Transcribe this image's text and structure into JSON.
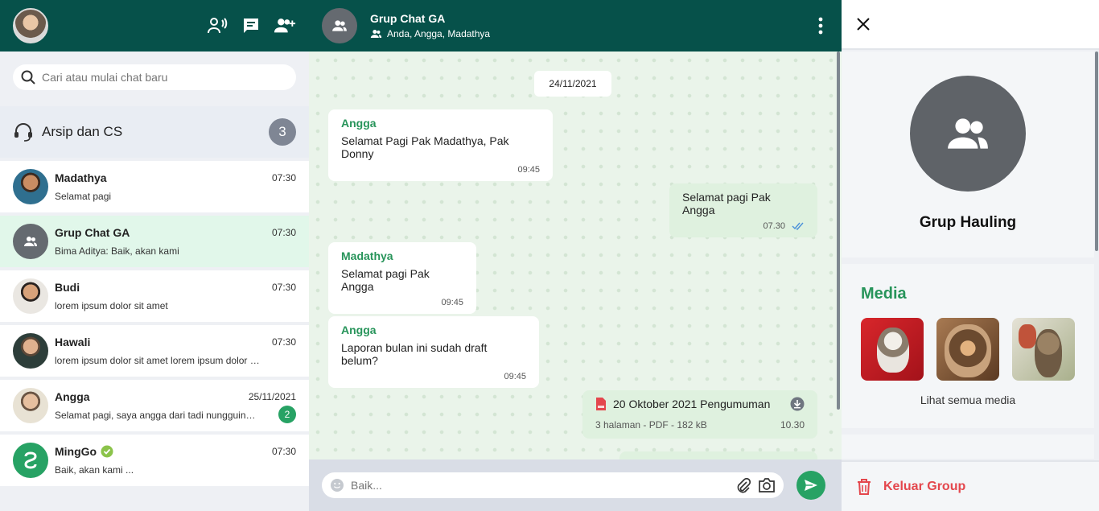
{
  "colors": {
    "header_bg": "#06514a",
    "accent_green": "#27a264",
    "sender_green": "#27945a",
    "danger": "#e4474d",
    "active_row": "#e1f7ea"
  },
  "search": {
    "placeholder": "Cari atau mulai chat baru"
  },
  "archive": {
    "label": "Arsip dan CS",
    "count": "3"
  },
  "chats": [
    {
      "name": "Madathya",
      "time": "07:30",
      "preview": "Selamat pagi",
      "avatar": "photo"
    },
    {
      "name": "Grup Chat GA",
      "time": "07:30",
      "preview": "Bima Aditya: Baik, akan kami",
      "avatar": "group-icon",
      "active": true
    },
    {
      "name": "Budi",
      "time": "07:30",
      "preview": "lorem ipsum dolor sit amet",
      "avatar": "photo"
    },
    {
      "name": "Hawali",
      "time": "07:30",
      "preview": "lorem ipsum dolor sit amet lorem ipsum dolor sit amet",
      "avatar": "photo"
    },
    {
      "name": "Angga",
      "time": "25/11/2021",
      "preview": "Selamat pagi, saya angga dari tadi nungguin kabar",
      "badge": "2",
      "avatar": "photo"
    },
    {
      "name": "MingGo",
      "time": "07:30",
      "preview": "Baik, akan kami ...",
      "verified": true,
      "avatar": "logo"
    }
  ],
  "conversation": {
    "title": "Grup Chat GA",
    "members": "Anda, Angga, Madathya",
    "date": "24/11/2021",
    "messages": [
      {
        "sender": "Angga",
        "text": "Selamat Pagi Pak Madathya, Pak Donny",
        "time": "09:45",
        "dir": "in"
      },
      {
        "text": "Selamat pagi Pak Angga",
        "time": "07.30",
        "dir": "out"
      },
      {
        "sender": "Madathya",
        "text": "Selamat pagi Pak Angga",
        "time": "09:45",
        "dir": "in"
      },
      {
        "sender": "Angga",
        "text": "Laporan bulan ini sudah draft belum?",
        "time": "09:45",
        "dir": "in"
      }
    ],
    "file": {
      "name": "20 Oktober 2021 Pengumuman",
      "meta": "3 halaman - PDF - 182 kB",
      "time": "10.30"
    }
  },
  "composer": {
    "placeholder": "Baik..."
  },
  "info_panel": {
    "name": "Grup Hauling",
    "media_title": "Media",
    "see_all": "Lihat semua media",
    "leave_label": "Keluar Group",
    "thumbnails": [
      "cat-photo-1",
      "cat-photo-2",
      "cat-photo-3"
    ]
  }
}
